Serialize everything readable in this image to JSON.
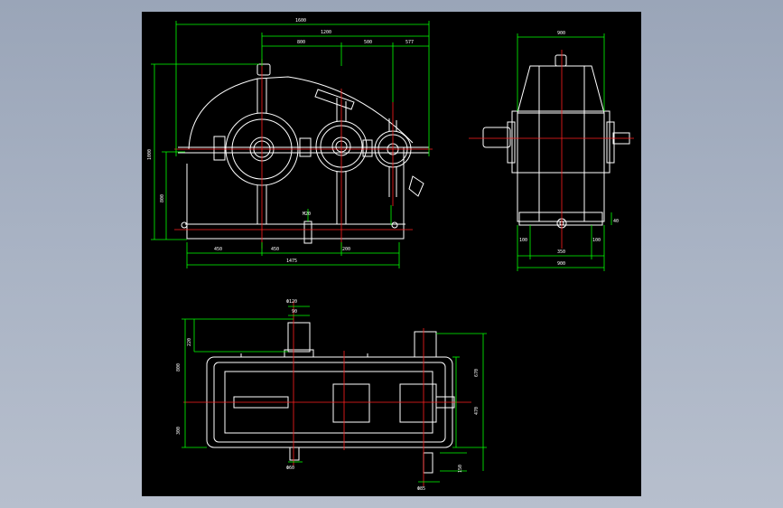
{
  "colors": {
    "background": "#a3adbf",
    "canvas": "#000000",
    "outline": "#ffffff",
    "dimension": "#00ff00",
    "centerline": "#ff2020"
  },
  "front_view": {
    "dim_total_width": "1600",
    "dim_span": "1200",
    "dim_seg1": "800",
    "dim_seg2": "500",
    "dim_seg3": "577",
    "dim_height_total": "1000",
    "dim_height_center": "800",
    "dim_base1": "450",
    "dim_base2": "450",
    "dim_base3": "200",
    "dim_base_total": "1475",
    "dim_bolt": "M20"
  },
  "side_view": {
    "dim_top": "900",
    "dim_left_foot": "100",
    "dim_right_foot": "100",
    "dim_base_inner": "350",
    "dim_base_total": "900",
    "dim_foot_height": "40"
  },
  "top_view": {
    "dim_shaft_top": "Ф120",
    "dim_shaft_key": "90",
    "dim_left_top": "220",
    "dim_left_full": "800",
    "dim_left_lower": "300",
    "dim_right_upper": "670",
    "dim_right_lower": "470",
    "dim_bottom_shaft": "Ф60",
    "dim_right_shaft": "150",
    "dim_bottom_right": "Ф85"
  }
}
